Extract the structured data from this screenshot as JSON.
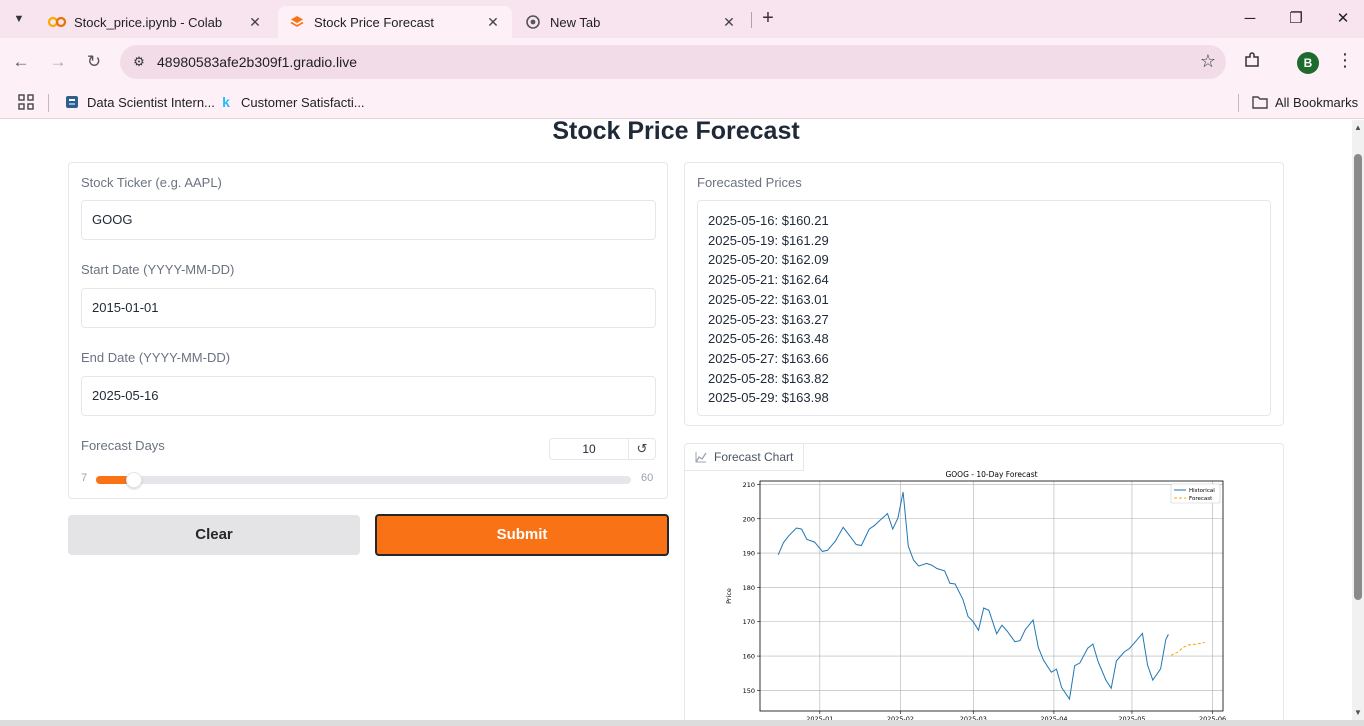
{
  "browser": {
    "tabs": [
      {
        "title": "Stock_price.ipynb - Colab",
        "icon": "colab-icon"
      },
      {
        "title": "Stock Price Forecast",
        "icon": "gradio-icon"
      },
      {
        "title": "New Tab",
        "icon": "chrome-icon"
      }
    ],
    "active_tab": 1,
    "url": "48980583afe2b309f1.gradio.live",
    "profile_initial": "B",
    "bookmarks": [
      {
        "label": "Data Scientist Intern...",
        "icon": "bookmark-doc-icon"
      },
      {
        "label": "Customer Satisfacti...",
        "icon": "kaggle-icon"
      }
    ],
    "all_bookmarks_label": "All Bookmarks"
  },
  "app": {
    "title": "Stock Price Forecast",
    "ticker": {
      "label": "Stock Ticker (e.g. AAPL)",
      "value": "GOOG"
    },
    "start_date": {
      "label": "Start Date (YYYY-MM-DD)",
      "value": "2015-01-01"
    },
    "end_date": {
      "label": "End Date (YYYY-MM-DD)",
      "value": "2025-05-16"
    },
    "forecast_days": {
      "label": "Forecast Days",
      "value": 10,
      "min": 7,
      "max": 60
    },
    "clear_label": "Clear",
    "submit_label": "Submit",
    "forecasted_prices": {
      "label": "Forecasted Prices",
      "lines": [
        "2025-05-16: $160.21",
        "2025-05-19: $161.29",
        "2025-05-20: $162.09",
        "2025-05-21: $162.64",
        "2025-05-22: $163.01",
        "2025-05-23: $163.27",
        "2025-05-26: $163.48",
        "2025-05-27: $163.66",
        "2025-05-28: $163.82",
        "2025-05-29: $163.98"
      ]
    },
    "chart_tab_label": "Forecast Chart",
    "colors": {
      "accent": "#f97316",
      "historical": "#1f77b4",
      "forecast": "#ffa500"
    }
  },
  "chart_data": {
    "type": "line",
    "title": "GOOG - 10-Day Forecast",
    "xlabel": "",
    "ylabel": "Price",
    "x_ticks": [
      "2025-01",
      "2025-02",
      "2025-03",
      "2025-04",
      "2025-05",
      "2025-06"
    ],
    "y_ticks": [
      150,
      160,
      170,
      180,
      190,
      200,
      210
    ],
    "xlim": [
      "2024-12-09",
      "2025-06-05"
    ],
    "ylim": [
      144,
      211
    ],
    "grid": true,
    "legend_position": "top-right",
    "series": [
      {
        "name": "Historical",
        "style": "solid",
        "x": [
          "2024-12-16",
          "2024-12-18",
          "2024-12-20",
          "2024-12-23",
          "2024-12-25",
          "2024-12-27",
          "2024-12-30",
          "2025-01-02",
          "2025-01-04",
          "2025-01-07",
          "2025-01-10",
          "2025-01-13",
          "2025-01-15",
          "2025-01-17",
          "2025-01-20",
          "2025-01-22",
          "2025-01-24",
          "2025-01-27",
          "2025-01-29",
          "2025-01-31",
          "2025-02-02",
          "2025-02-04",
          "2025-02-06",
          "2025-02-08",
          "2025-02-11",
          "2025-02-13",
          "2025-02-15",
          "2025-02-18",
          "2025-02-20",
          "2025-02-22",
          "2025-02-25",
          "2025-02-27",
          "2025-03-01",
          "2025-03-03",
          "2025-03-05",
          "2025-03-07",
          "2025-03-10",
          "2025-03-12",
          "2025-03-14",
          "2025-03-17",
          "2025-03-19",
          "2025-03-21",
          "2025-03-24",
          "2025-03-26",
          "2025-03-28",
          "2025-03-31",
          "2025-04-02",
          "2025-04-04",
          "2025-04-07",
          "2025-04-09",
          "2025-04-11",
          "2025-04-14",
          "2025-04-16",
          "2025-04-18",
          "2025-04-21",
          "2025-04-23",
          "2025-04-25",
          "2025-04-28",
          "2025-04-30",
          "2025-05-02",
          "2025-05-05",
          "2025-05-07",
          "2025-05-09",
          "2025-05-12",
          "2025-05-14",
          "2025-05-15"
        ],
        "y": [
          189.5,
          193.0,
          195.0,
          197.3,
          197.0,
          194.0,
          193.2,
          190.5,
          190.8,
          193.5,
          197.5,
          194.5,
          192.5,
          192.2,
          197.0,
          198.0,
          199.5,
          201.5,
          197.0,
          200.2,
          207.8,
          192.0,
          188.0,
          186.2,
          187.0,
          186.5,
          185.5,
          184.8,
          181.2,
          181.0,
          176.5,
          171.5,
          170.0,
          167.5,
          174.0,
          173.3,
          166.5,
          169.0,
          167.3,
          164.2,
          164.5,
          167.7,
          170.5,
          162.5,
          158.8,
          155.3,
          156.2,
          150.8,
          147.5,
          157.2,
          158.0,
          162.3,
          163.5,
          158.4,
          153.0,
          150.6,
          158.6,
          161.2,
          162.2,
          163.9,
          166.6,
          157.3,
          153.0,
          156.3,
          164.8,
          166.3
        ]
      },
      {
        "name": "Forecast",
        "style": "dashed",
        "x": [
          "2025-05-16",
          "2025-05-19",
          "2025-05-20",
          "2025-05-21",
          "2025-05-22",
          "2025-05-23",
          "2025-05-26",
          "2025-05-27",
          "2025-05-28",
          "2025-05-29"
        ],
        "y": [
          160.21,
          161.29,
          162.09,
          162.64,
          163.01,
          163.27,
          163.48,
          163.66,
          163.82,
          163.98
        ]
      }
    ]
  }
}
